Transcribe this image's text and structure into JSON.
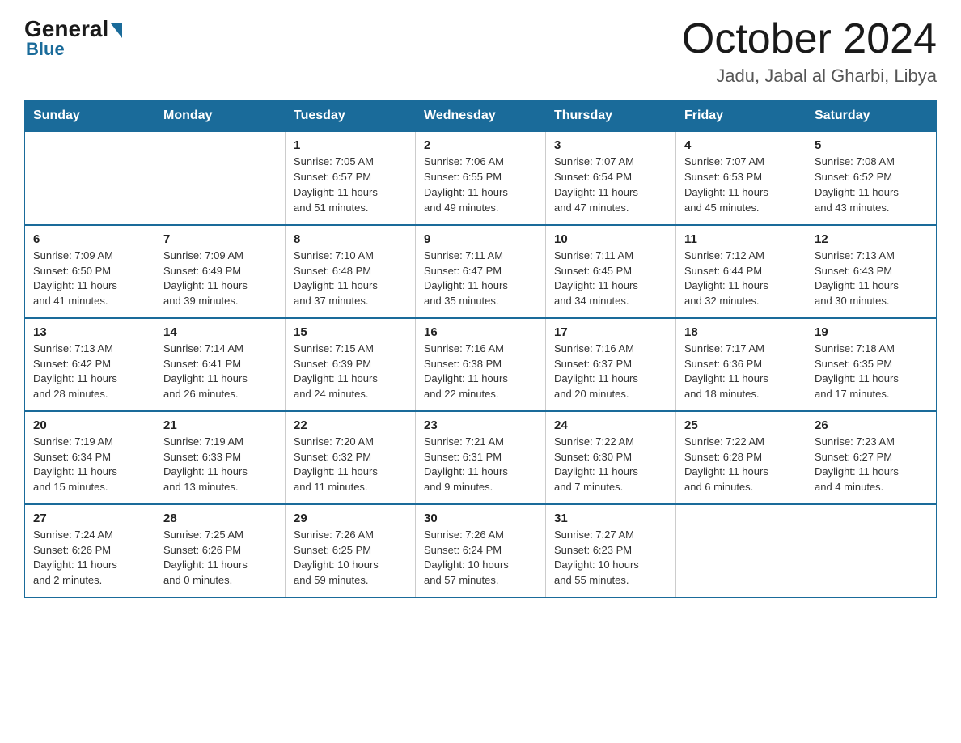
{
  "logo": {
    "general_text": "General",
    "blue_text": "Blue"
  },
  "header": {
    "month_year": "October 2024",
    "location": "Jadu, Jabal al Gharbi, Libya"
  },
  "weekdays": [
    "Sunday",
    "Monday",
    "Tuesday",
    "Wednesday",
    "Thursday",
    "Friday",
    "Saturday"
  ],
  "weeks": [
    [
      {
        "day": "",
        "info": ""
      },
      {
        "day": "",
        "info": ""
      },
      {
        "day": "1",
        "info": "Sunrise: 7:05 AM\nSunset: 6:57 PM\nDaylight: 11 hours\nand 51 minutes."
      },
      {
        "day": "2",
        "info": "Sunrise: 7:06 AM\nSunset: 6:55 PM\nDaylight: 11 hours\nand 49 minutes."
      },
      {
        "day": "3",
        "info": "Sunrise: 7:07 AM\nSunset: 6:54 PM\nDaylight: 11 hours\nand 47 minutes."
      },
      {
        "day": "4",
        "info": "Sunrise: 7:07 AM\nSunset: 6:53 PM\nDaylight: 11 hours\nand 45 minutes."
      },
      {
        "day": "5",
        "info": "Sunrise: 7:08 AM\nSunset: 6:52 PM\nDaylight: 11 hours\nand 43 minutes."
      }
    ],
    [
      {
        "day": "6",
        "info": "Sunrise: 7:09 AM\nSunset: 6:50 PM\nDaylight: 11 hours\nand 41 minutes."
      },
      {
        "day": "7",
        "info": "Sunrise: 7:09 AM\nSunset: 6:49 PM\nDaylight: 11 hours\nand 39 minutes."
      },
      {
        "day": "8",
        "info": "Sunrise: 7:10 AM\nSunset: 6:48 PM\nDaylight: 11 hours\nand 37 minutes."
      },
      {
        "day": "9",
        "info": "Sunrise: 7:11 AM\nSunset: 6:47 PM\nDaylight: 11 hours\nand 35 minutes."
      },
      {
        "day": "10",
        "info": "Sunrise: 7:11 AM\nSunset: 6:45 PM\nDaylight: 11 hours\nand 34 minutes."
      },
      {
        "day": "11",
        "info": "Sunrise: 7:12 AM\nSunset: 6:44 PM\nDaylight: 11 hours\nand 32 minutes."
      },
      {
        "day": "12",
        "info": "Sunrise: 7:13 AM\nSunset: 6:43 PM\nDaylight: 11 hours\nand 30 minutes."
      }
    ],
    [
      {
        "day": "13",
        "info": "Sunrise: 7:13 AM\nSunset: 6:42 PM\nDaylight: 11 hours\nand 28 minutes."
      },
      {
        "day": "14",
        "info": "Sunrise: 7:14 AM\nSunset: 6:41 PM\nDaylight: 11 hours\nand 26 minutes."
      },
      {
        "day": "15",
        "info": "Sunrise: 7:15 AM\nSunset: 6:39 PM\nDaylight: 11 hours\nand 24 minutes."
      },
      {
        "day": "16",
        "info": "Sunrise: 7:16 AM\nSunset: 6:38 PM\nDaylight: 11 hours\nand 22 minutes."
      },
      {
        "day": "17",
        "info": "Sunrise: 7:16 AM\nSunset: 6:37 PM\nDaylight: 11 hours\nand 20 minutes."
      },
      {
        "day": "18",
        "info": "Sunrise: 7:17 AM\nSunset: 6:36 PM\nDaylight: 11 hours\nand 18 minutes."
      },
      {
        "day": "19",
        "info": "Sunrise: 7:18 AM\nSunset: 6:35 PM\nDaylight: 11 hours\nand 17 minutes."
      }
    ],
    [
      {
        "day": "20",
        "info": "Sunrise: 7:19 AM\nSunset: 6:34 PM\nDaylight: 11 hours\nand 15 minutes."
      },
      {
        "day": "21",
        "info": "Sunrise: 7:19 AM\nSunset: 6:33 PM\nDaylight: 11 hours\nand 13 minutes."
      },
      {
        "day": "22",
        "info": "Sunrise: 7:20 AM\nSunset: 6:32 PM\nDaylight: 11 hours\nand 11 minutes."
      },
      {
        "day": "23",
        "info": "Sunrise: 7:21 AM\nSunset: 6:31 PM\nDaylight: 11 hours\nand 9 minutes."
      },
      {
        "day": "24",
        "info": "Sunrise: 7:22 AM\nSunset: 6:30 PM\nDaylight: 11 hours\nand 7 minutes."
      },
      {
        "day": "25",
        "info": "Sunrise: 7:22 AM\nSunset: 6:28 PM\nDaylight: 11 hours\nand 6 minutes."
      },
      {
        "day": "26",
        "info": "Sunrise: 7:23 AM\nSunset: 6:27 PM\nDaylight: 11 hours\nand 4 minutes."
      }
    ],
    [
      {
        "day": "27",
        "info": "Sunrise: 7:24 AM\nSunset: 6:26 PM\nDaylight: 11 hours\nand 2 minutes."
      },
      {
        "day": "28",
        "info": "Sunrise: 7:25 AM\nSunset: 6:26 PM\nDaylight: 11 hours\nand 0 minutes."
      },
      {
        "day": "29",
        "info": "Sunrise: 7:26 AM\nSunset: 6:25 PM\nDaylight: 10 hours\nand 59 minutes."
      },
      {
        "day": "30",
        "info": "Sunrise: 7:26 AM\nSunset: 6:24 PM\nDaylight: 10 hours\nand 57 minutes."
      },
      {
        "day": "31",
        "info": "Sunrise: 7:27 AM\nSunset: 6:23 PM\nDaylight: 10 hours\nand 55 minutes."
      },
      {
        "day": "",
        "info": ""
      },
      {
        "day": "",
        "info": ""
      }
    ]
  ]
}
